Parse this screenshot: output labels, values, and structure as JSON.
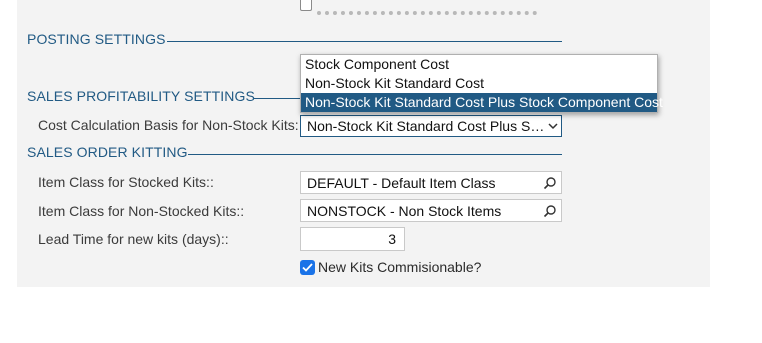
{
  "sections": {
    "posting": "POSTING SETTINGS",
    "sales_profitability": "SALES PROFITABILITY SETTINGS",
    "sales_order_kitting": "SALES ORDER KITTING"
  },
  "fields": {
    "cost_calc": {
      "label": "Cost Calculation Basis for Non-Stock Kits:",
      "value": "Non-Stock Kit Standard Cost Plus St…"
    },
    "item_class_stocked": {
      "label": "Item Class for Stocked Kits::",
      "value": "DEFAULT - Default Item Class"
    },
    "item_class_nonstocked": {
      "label": "Item Class for Non-Stocked Kits::",
      "value": "NONSTOCK - Non Stock Items"
    },
    "lead_time": {
      "label": "Lead Time for new kits (days)::",
      "value": "3"
    },
    "commissionable": {
      "label": "New Kits Commisionable?",
      "checked": true
    }
  },
  "dropdown": {
    "options": [
      "Stock Component Cost",
      "Non-Stock Kit Standard Cost",
      "Non-Stock Kit Standard Cost Plus Stock Component Cost"
    ],
    "selected_index": 2
  },
  "colors": {
    "accent": "#215a84",
    "checkbox": "#1a73e8",
    "panel": "#f3f3f3"
  },
  "icons": {
    "search": "search-icon",
    "chevron": "chevron-down-icon",
    "check": "checkmark-icon"
  }
}
